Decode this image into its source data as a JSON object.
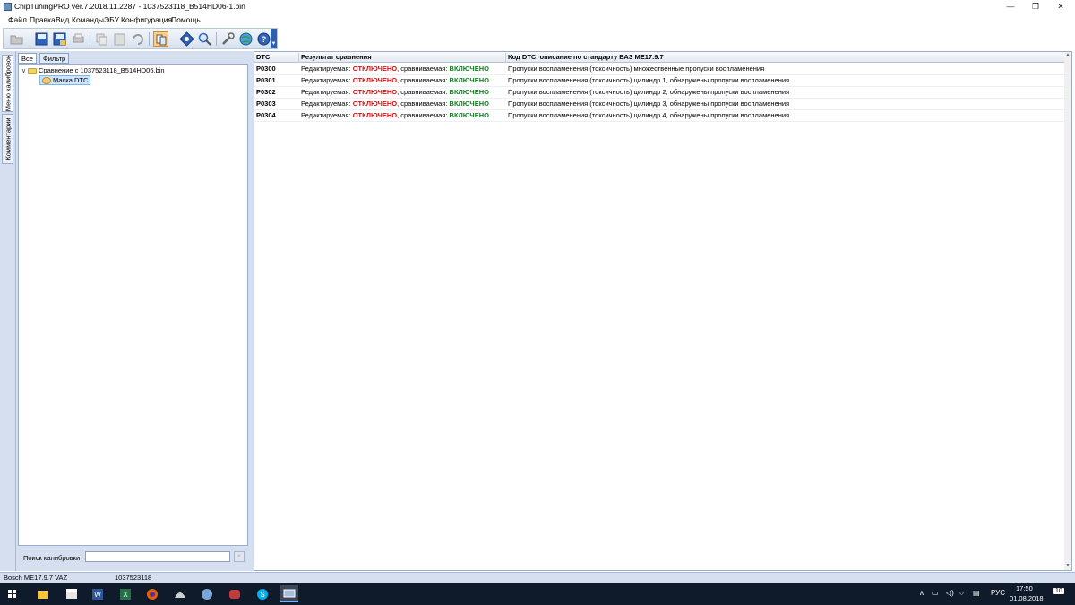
{
  "window": {
    "title": "ChipTuningPRO ver.7.2018.11.2287 - 1037523118_B514HD06-1.bin",
    "minimize": "—",
    "maximize": "❐",
    "close": "✕"
  },
  "menu": [
    "Файл",
    "Правка",
    "Вид",
    "Команды",
    "ЭБУ",
    "Конфигурация",
    "Помощь"
  ],
  "side_tabs": {
    "calibrations": "Меню калибровок",
    "comments": "Комментарии"
  },
  "left_panel": {
    "filter_tabs": [
      "Все",
      "Фильтр"
    ],
    "tree": {
      "root": "Сравнение с 1037523118_B514HD06.bin",
      "child": "Маска DTC"
    },
    "search_label": "Поиск калибровки",
    "search_value": ""
  },
  "grid": {
    "columns": [
      "DTC",
      "Результат сравнения",
      "Код DTC, описание по стандарту ВАЗ ME17.9.7"
    ],
    "rows": [
      {
        "code": "P0300",
        "edit_label": "Редактируемая:",
        "edit_state": "ОТКЛЮЧЕНО",
        "cmp_label": ", сравниваемая:",
        "cmp_state": "ВКЛЮЧЕНО",
        "desc": "Пропуски воспламенения (токсичность) множественные пропуски воспламенения"
      },
      {
        "code": "P0301",
        "edit_label": "Редактируемая:",
        "edit_state": "ОТКЛЮЧЕНО",
        "cmp_label": ", сравниваемая:",
        "cmp_state": "ВКЛЮЧЕНО",
        "desc": "Пропуски воспламенения (токсичность) цилиндр 1, обнаружены пропуски воспламенения"
      },
      {
        "code": "P0302",
        "edit_label": "Редактируемая:",
        "edit_state": "ОТКЛЮЧЕНО",
        "cmp_label": ", сравниваемая:",
        "cmp_state": "ВКЛЮЧЕНО",
        "desc": "Пропуски воспламенения (токсичность) цилиндр 2, обнаружены пропуски воспламенения"
      },
      {
        "code": "P0303",
        "edit_label": "Редактируемая:",
        "edit_state": "ОТКЛЮЧЕНО",
        "cmp_label": ", сравниваемая:",
        "cmp_state": "ВКЛЮЧЕНО",
        "desc": "Пропуски воспламенения (токсичность) цилиндр 3, обнаружены пропуски воспламенения"
      },
      {
        "code": "P0304",
        "edit_label": "Редактируемая:",
        "edit_state": "ОТКЛЮЧЕНО",
        "cmp_label": ", сравниваемая:",
        "cmp_state": "ВКЛЮЧЕНО",
        "desc": "Пропуски воспламенения (токсичность) цилиндр 4, обнаружены пропуски воспламенения"
      }
    ]
  },
  "status": {
    "ecu": "Bosch ME17.9.7 VAZ",
    "file": "1037523118"
  },
  "taskbar": {
    "language": "РУС",
    "time": "17:50",
    "date": "01.08.2018",
    "notifications": "10"
  },
  "colors": {
    "off": "#d01010",
    "on": "#108020",
    "accent": "#2f5fa8"
  }
}
